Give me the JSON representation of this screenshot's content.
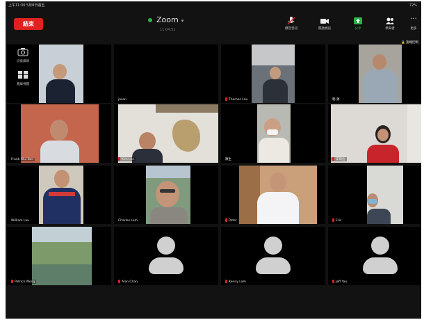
{
  "status_bar": {
    "left": "上午11:30  5月8日週五",
    "right": "72%"
  },
  "topbar": {
    "end_label": "結束",
    "title": "Zoom",
    "subtitle": "11:04:51",
    "buttons": [
      {
        "id": "mute",
        "label": "靜音音訊",
        "icon": "mic-off-icon"
      },
      {
        "id": "video",
        "label": "開啟視訊",
        "icon": "video-icon"
      },
      {
        "id": "share",
        "label": "分享",
        "icon": "share-icon",
        "accent": "#2bb34a"
      },
      {
        "id": "participants",
        "label": "參與者",
        "icon": "participants-icon"
      },
      {
        "id": "more",
        "label": "更多",
        "icon": "more-icon"
      }
    ]
  },
  "sidestrip": [
    {
      "label": "切換鏡頭",
      "icon": "camera-icon"
    },
    {
      "label": "圖庫視圖",
      "icon": "gallery-icon"
    }
  ],
  "share_hint": "🔒 遠端控制",
  "tiles": [
    {
      "name": "",
      "video": "man-dark-shirt"
    },
    {
      "name": "jason",
      "video": "dark"
    },
    {
      "name": "Thomas Lau",
      "muted": true,
      "video": "man-car"
    },
    {
      "name": "朝 源",
      "video": "man-grey"
    },
    {
      "name": "Frank Wui Ban",
      "video": "man-orange-curtain"
    },
    {
      "name": "Kim Lee",
      "muted": true,
      "video": "man-map-wall"
    },
    {
      "name": "陳生",
      "video": "man-mask"
    },
    {
      "name": "安琪拉",
      "muted": true,
      "video": "woman-red"
    },
    {
      "name": "William Lau",
      "video": "man-red-shirt"
    },
    {
      "name": "Charles Lam",
      "video": "man-glasses"
    },
    {
      "name": "Peter",
      "muted": true,
      "video": "man-white-shirt"
    },
    {
      "name": "Eric",
      "muted": true,
      "video": "man-mask-2"
    },
    {
      "name": "Patrick Wong",
      "muted": true,
      "video": "landscape"
    },
    {
      "name": "Alan Chan",
      "muted": true,
      "video": "avatar"
    },
    {
      "name": "Kenny Lam",
      "muted": true,
      "video": "avatar"
    },
    {
      "name": "Jeff Yau",
      "muted": true,
      "video": "avatar"
    }
  ],
  "colors": {
    "end": "#e0211f",
    "connected": "#2bb34a",
    "bg": "#121212",
    "avatar": "#d0d0d0"
  }
}
